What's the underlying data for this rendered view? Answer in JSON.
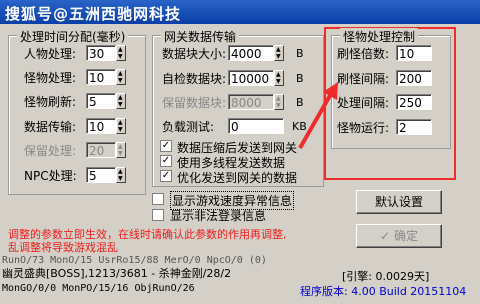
{
  "window": {
    "title": "搜狐号@五洲西驰网科技"
  },
  "time_group": {
    "title": "处理时间分配(毫秒)",
    "rows": [
      {
        "label": "人物处理:",
        "value": "30",
        "enabled": true
      },
      {
        "label": "怪物处理:",
        "value": "10",
        "enabled": true
      },
      {
        "label": "怪物刷新:",
        "value": "5",
        "enabled": true
      },
      {
        "label": "数据传输:",
        "value": "10",
        "enabled": true
      },
      {
        "label": "保留处理:",
        "value": "20",
        "enabled": false
      },
      {
        "label": "NPC处理:",
        "value": "5",
        "enabled": true
      }
    ]
  },
  "gateway_group": {
    "title": "网关数据传输",
    "rows": [
      {
        "label": "数据块大小:",
        "value": "4000",
        "unit": "B",
        "enabled": true
      },
      {
        "label": "自检数据块:",
        "value": "10000",
        "unit": "B",
        "enabled": true
      },
      {
        "label": "保留数据块:",
        "value": "8000",
        "unit": "B",
        "enabled": false
      },
      {
        "label": "负载测试:",
        "value": "0",
        "unit": "KB",
        "enabled": true
      }
    ],
    "checks": [
      {
        "label": "数据压缩后发送到网关",
        "checked": true
      },
      {
        "label": "使用多线程发送数据",
        "checked": true
      },
      {
        "label": "优化发送到网关的数据",
        "checked": true
      }
    ]
  },
  "monster_group": {
    "title": "怪物处理控制",
    "rows": [
      {
        "label": "刷怪倍数:",
        "value": "10"
      },
      {
        "label": "刷怪间隔:",
        "value": "200"
      },
      {
        "label": "处理间隔:",
        "value": "250"
      },
      {
        "label": "怪物运行:",
        "value": "2"
      }
    ]
  },
  "options": [
    {
      "label": "显示游戏速度异常信息",
      "checked": false
    },
    {
      "label": "显示非法登录信息",
      "checked": false
    }
  ],
  "buttons": {
    "default_label": "默认设置",
    "ok_label": "确定",
    "ok_check": "✓"
  },
  "warning": {
    "line1": "调整的参数立即生效，在线时请确认此参数的作用再调整,",
    "line2": "乱调整将导致游戏混乱"
  },
  "log": {
    "line1": "RunO/73 MonO/15 UsrRo15/88 MerO/0 NpcO/0 (0)",
    "line2": "幽灵盛典[BOSS],1213/3681 - 杀神金刚/28/2",
    "line3": "MonGO/0/0 MonPO/15/16 ObjRunO/26"
  },
  "status": {
    "memory": "[引擎: 0.0029天]",
    "version": "程序版本: 4.00 Build 20151104"
  },
  "colors": {
    "highlight": "#ef2b2b",
    "title_bar": "#0a3ea8",
    "version_text": "#0000cc"
  }
}
